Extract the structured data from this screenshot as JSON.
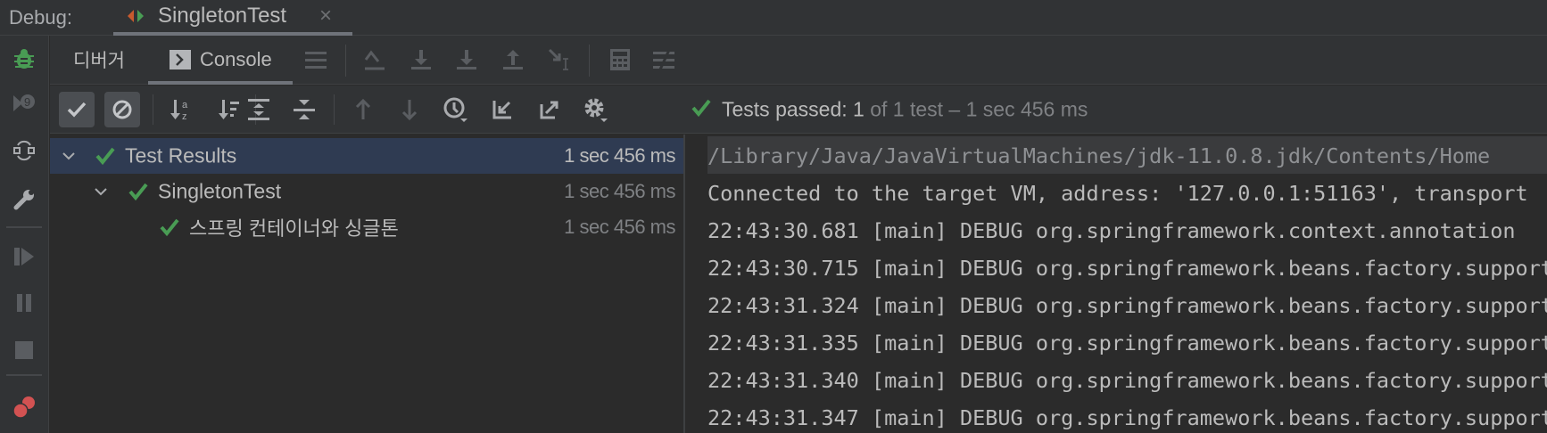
{
  "titlebar": {
    "label": "Debug:",
    "tab": "SingletonTest"
  },
  "tabs": {
    "debugger": "디버거",
    "console": "Console"
  },
  "status": {
    "prefix": "Tests passed: ",
    "passed": "1",
    "rest": " of 1 test – 1 sec 456 ms"
  },
  "tree": [
    {
      "label": "Test Results",
      "time": "1 sec 456 ms"
    },
    {
      "label": "SingletonTest",
      "time": "1 sec 456 ms"
    },
    {
      "label": "스프링 컨테이너와 싱글톤",
      "time": "1 sec 456 ms"
    }
  ],
  "console": [
    "/Library/Java/JavaVirtualMachines/jdk-11.0.8.jdk/Contents/Home",
    "Connected to the target VM, address: '127.0.0.1:51163', transport",
    "22:43:30.681 [main] DEBUG org.springframework.context.annotation",
    "22:43:30.715 [main] DEBUG org.springframework.beans.factory.support",
    "22:43:31.324 [main] DEBUG org.springframework.beans.factory.support",
    "22:43:31.335 [main] DEBUG org.springframework.beans.factory.support",
    "22:43:31.340 [main] DEBUG org.springframework.beans.factory.support",
    "22:43:31.347 [main] DEBUG org.springframework.beans.factory.support"
  ],
  "colors": {
    "green": "#499c54",
    "selected": "#2f3b52",
    "text": "#bbbbbb"
  }
}
